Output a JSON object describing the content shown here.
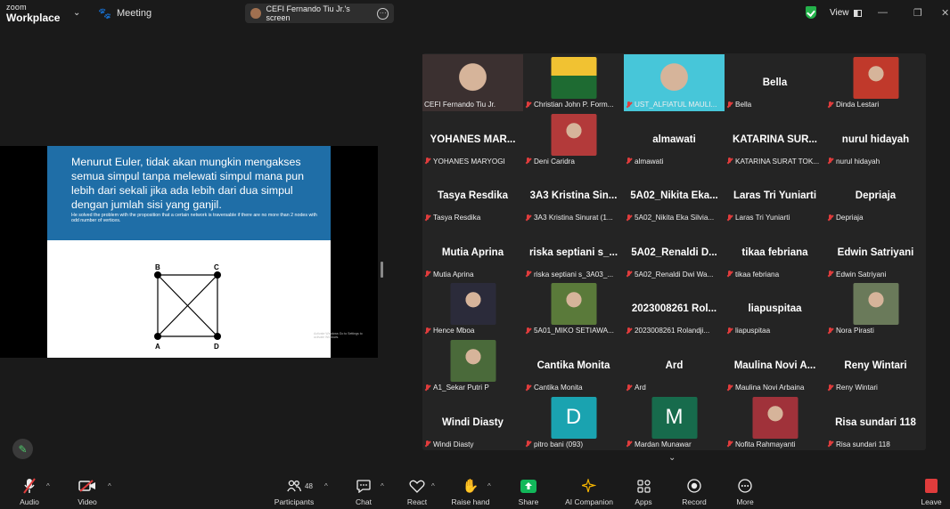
{
  "app": {
    "brand_small": "zoom",
    "brand_large": "Workplace",
    "meeting_label": "Meeting"
  },
  "share": {
    "label": "CEFI Fernando Tiu Jr.'s screen",
    "more": "···"
  },
  "header": {
    "view_label": "View",
    "minimize": "—",
    "restore": "❐",
    "close": "✕"
  },
  "slide": {
    "title": "Menurut Euler, tidak akan mungkin mengakses semua simpul tanpa melewati simpul mana pun lebih dari sekali jika ada lebih dari dua simpul dengan jumlah sisi yang ganjil.",
    "note": "He solved the problem with the proposition that a certain network is traversable if there are no more than 2 nodes with odd number of vertices.",
    "nodes": {
      "a": "A",
      "b": "B",
      "c": "C",
      "d": "D"
    },
    "watermark": "Activate Windows Go to Settings to activate Windows."
  },
  "participants": [
    {
      "name": "CEFI Fernando Tiu Jr.",
      "label": "CEFI Fernando Tiu Jr.",
      "type": "video",
      "color": "#3b3030",
      "active": true
    },
    {
      "name": "Christian John P. Form...",
      "label": "Christian John P. Form...",
      "type": "logo",
      "color": "#f1c232"
    },
    {
      "name": "UST_ALFIATUL MAULI...",
      "label": "UST_ALFIATUL MAULI...",
      "type": "video",
      "color": "#47c6d9"
    },
    {
      "name": "Bella",
      "label": "Bella",
      "type": "name"
    },
    {
      "name": "Dinda Lestari",
      "label": "Dinda Lestari",
      "type": "photo",
      "color": "#c0392b"
    },
    {
      "name": "YOHANES MAR...",
      "label": "YOHANES MARYOGI",
      "type": "name"
    },
    {
      "name": "Deni Caridra",
      "label": "Deni Caridra",
      "type": "photo",
      "color": "#b33a3a"
    },
    {
      "name": "almawati",
      "label": "almawati",
      "type": "name"
    },
    {
      "name": "KATARINA SUR...",
      "label": "KATARINA SURAT TOK...",
      "type": "name"
    },
    {
      "name": "nurul hidayah",
      "label": "nurul hidayah",
      "type": "name"
    },
    {
      "name": "Tasya Resdika",
      "label": "Tasya Resdika",
      "type": "name"
    },
    {
      "name": "3A3 Kristina Sin...",
      "label": "3A3 Kristina Sinurat (1...",
      "type": "name"
    },
    {
      "name": "5A02_Nikita Eka...",
      "label": "5A02_Nikita Eka Silvia...",
      "type": "name"
    },
    {
      "name": "Laras Tri Yuniarti",
      "label": "Laras Tri Yuniarti",
      "type": "name"
    },
    {
      "name": "Depriaja",
      "label": "Depriaja",
      "type": "name"
    },
    {
      "name": "Mutia Aprina",
      "label": "Mutia Aprina",
      "type": "name"
    },
    {
      "name": "riska septiani s_...",
      "label": "riska septiani s_3A03_...",
      "type": "name"
    },
    {
      "name": "5A02_Renaldi D...",
      "label": "5A02_Renaldi Dwi Wa...",
      "type": "name"
    },
    {
      "name": "tikaa febriana",
      "label": "tikaa febriana",
      "type": "name"
    },
    {
      "name": "Edwin Satriyani",
      "label": "Edwin Satriyani",
      "type": "name"
    },
    {
      "name": "Hence Mboa",
      "label": "Hence Mboa",
      "type": "photo",
      "color": "#2b2b3a"
    },
    {
      "name": "5A01_MIKO SETIAWA...",
      "label": "5A01_MIKO SETIAWA...",
      "type": "photo",
      "color": "#5a7a3a"
    },
    {
      "name": "2023008261 Rol...",
      "label": "2023008261 Rolandji...",
      "type": "name"
    },
    {
      "name": "liapuspitaa",
      "label": "liapuspitaa",
      "type": "name"
    },
    {
      "name": "Nora Pirasti",
      "label": "Nora Pirasti",
      "type": "photo",
      "color": "#6a7a5a"
    },
    {
      "name": "A1_Sekar Putri P",
      "label": "A1_Sekar Putri P",
      "type": "photo",
      "color": "#4a6a3a"
    },
    {
      "name": "Cantika Monita",
      "label": "Cantika Monita",
      "type": "name"
    },
    {
      "name": "Ard",
      "label": "Ard",
      "type": "name"
    },
    {
      "name": "Maulina Novi A...",
      "label": "Maulina Novi Arbaina",
      "type": "name"
    },
    {
      "name": "Reny Wintari",
      "label": "Reny Wintari",
      "type": "name"
    },
    {
      "name": "Windi Diasty",
      "label": "Windi Diasty",
      "type": "name"
    },
    {
      "name": "D",
      "label": "pitro bani (093)",
      "type": "letter",
      "color": "#1aa3b0"
    },
    {
      "name": "M",
      "label": "Mardan Munawar",
      "type": "letter",
      "color": "#176b4c"
    },
    {
      "name": "Nofita Rahmayanti",
      "label": "Nofita Rahmayanti",
      "type": "photo",
      "color": "#a0323a"
    },
    {
      "name": "Risa sundari 118",
      "label": "Risa sundari 118",
      "type": "name"
    }
  ],
  "toolbar": {
    "audio": "Audio",
    "video": "Video",
    "participants": "Participants",
    "participants_count": "48",
    "chat": "Chat",
    "react": "React",
    "raise_hand": "Raise hand",
    "share": "Share",
    "ai_companion": "AI Companion",
    "apps": "Apps",
    "record": "Record",
    "more": "More",
    "leave": "Leave"
  },
  "colors": {
    "accent_green": "#2dd373",
    "mute_red": "#e03c3c",
    "slide_blue": "#1f6ea7"
  }
}
